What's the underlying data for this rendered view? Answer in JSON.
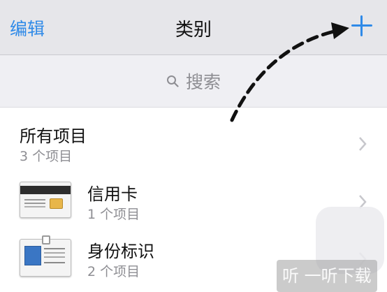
{
  "navbar": {
    "edit_label": "编辑",
    "title": "类别",
    "add_icon": "plus-icon"
  },
  "search": {
    "placeholder": "搜索",
    "icon": "search-icon"
  },
  "categories": [
    {
      "title": "所有项目",
      "count": "3 个项目",
      "icon": ""
    },
    {
      "title": "信用卡",
      "count": "1 个项目",
      "icon": "credit-card-icon"
    },
    {
      "title": "身份标识",
      "count": "2 个项目",
      "icon": "id-badge-icon"
    }
  ],
  "watermark": {
    "text": "一听下载",
    "logo_glyph": "听"
  },
  "colors": {
    "accent": "#2f8ae8",
    "nav_bg": "#e6e6ea",
    "search_bg": "#efeff3"
  }
}
